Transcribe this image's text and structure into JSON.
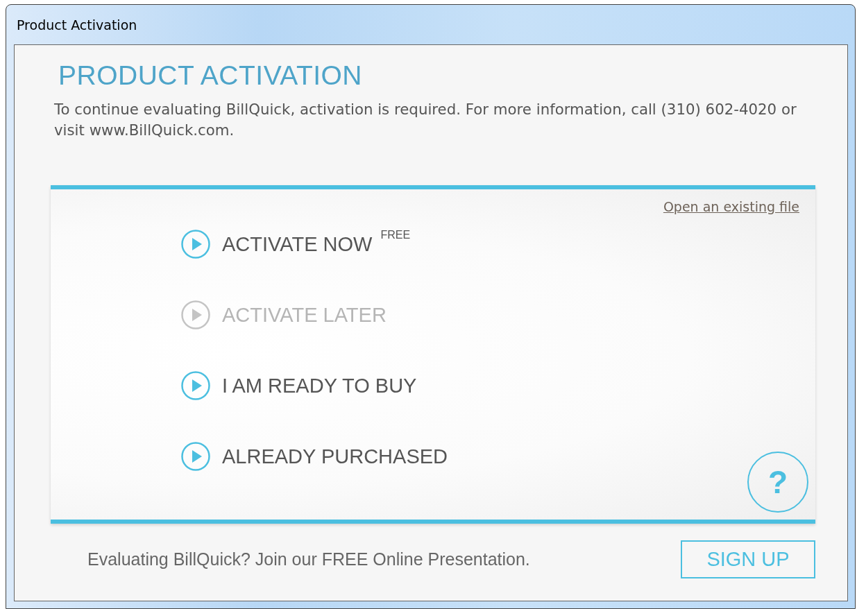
{
  "window": {
    "title": "Product Activation"
  },
  "heading": "PRODUCT ACTIVATION",
  "intro": "To continue evaluating BillQuick, activation is required. For more information, call (310) 602-4020 or visit www.BillQuick.com.",
  "panel": {
    "link": "Open an existing file",
    "options": [
      {
        "label": "ACTIVATE NOW $^{FREE}$",
        "disabled": false
      },
      {
        "label": "ACTIVATE LATER",
        "disabled": true
      },
      {
        "label": "I AM READY TO BUY",
        "disabled": false
      },
      {
        "label": "ALREADY PURCHASED",
        "disabled": false
      }
    ],
    "help": "?"
  },
  "footer": {
    "text": "Evaluating BillQuick? Join our FREE Online Presentation.",
    "button": "SIGN UP"
  }
}
